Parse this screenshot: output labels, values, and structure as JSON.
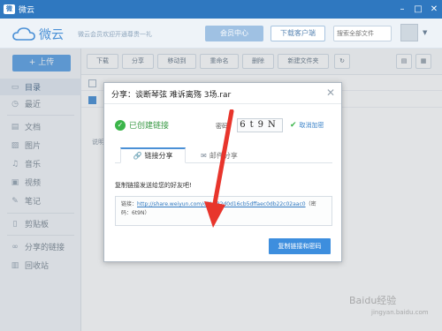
{
  "window": {
    "title": "微云",
    "badge": "微"
  },
  "header": {
    "brand": "微云",
    "slogan": "微云会员欢迎开通尊贵一礼",
    "vip_label": "会员中心",
    "download_label": "下载客户端",
    "search_placeholder": "搜索全部文件"
  },
  "sidebar": {
    "upload_label": "+ 上传",
    "items": [
      {
        "label": "目录",
        "icon": "folder-icon"
      },
      {
        "label": "最近",
        "icon": "clock-icon"
      },
      {
        "label": "文档",
        "icon": "document-icon"
      },
      {
        "label": "图片",
        "icon": "image-icon"
      },
      {
        "label": "音乐",
        "icon": "music-icon"
      },
      {
        "label": "视频",
        "icon": "video-icon"
      },
      {
        "label": "笔记",
        "icon": "note-icon"
      },
      {
        "label": "剪贴板",
        "icon": "clipboard-icon"
      },
      {
        "label": "分享的链接",
        "icon": "link-icon"
      },
      {
        "label": "回收站",
        "icon": "trash-icon"
      }
    ]
  },
  "toolbar": {
    "download": "下载",
    "share": "分享",
    "move": "移动到",
    "rename": "重命名",
    "delete": "删除",
    "new_folder": "新建文件夹"
  },
  "content": {
    "desc": "说明"
  },
  "dialog": {
    "title": "分享：谈断琴弦 难诉离殇 3场.rar",
    "status": "已创建链接",
    "password_label": "密码：",
    "password": "6t9N",
    "cancel_password": "取消加密",
    "tabs": [
      {
        "label": "链接分享",
        "active": true
      },
      {
        "label": "邮件分享",
        "active": false
      }
    ],
    "copy_hint": "复制链接发送给您的好友吧!",
    "link_label": "链接：",
    "link_url": "http://share.weiyun.com/c9b682d0d16cb5dffaec0db22c02aac0",
    "link_suffix": "（密码：6t9N）",
    "copy_button": "复制链接和密码"
  },
  "watermark": {
    "line1": "Baidu经验",
    "line2": "jingyan.baidu.com"
  },
  "colors": {
    "accent": "#2f78c0",
    "success": "#3bb54a",
    "annotation": "#e8352c"
  }
}
